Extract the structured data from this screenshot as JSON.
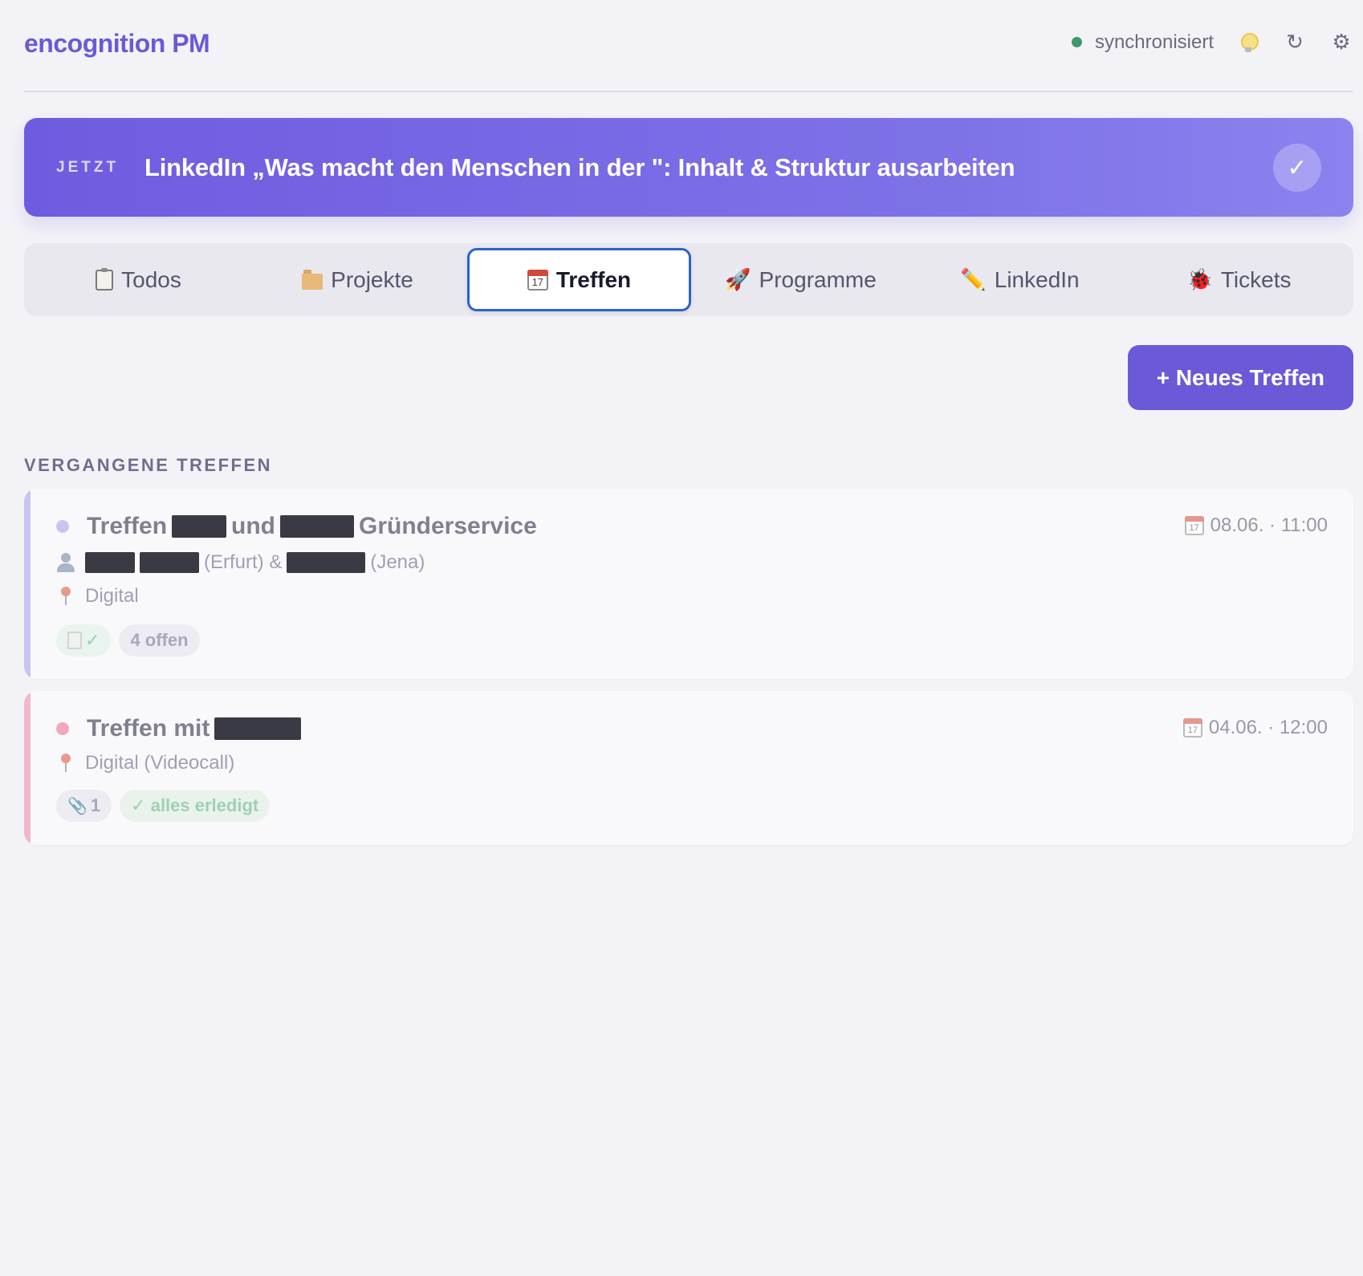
{
  "app": {
    "brand": "encognition PM",
    "sync_status": "synchronisiert",
    "refresh_icon": "↻",
    "settings_icon": "⚙"
  },
  "now": {
    "label": "JETZT",
    "title": "LinkedIn „Was macht den Menschen in der \": Inhalt & Struktur ausarbeiten",
    "done_icon": "✓"
  },
  "tabs": [
    {
      "label": "Todos",
      "icon": "clipboard-icon"
    },
    {
      "label": "Projekte",
      "icon": "folder-icon"
    },
    {
      "label": "Treffen",
      "icon": "calendar-icon",
      "active": true
    },
    {
      "label": "Programme",
      "icon": "rocket-icon",
      "glyph": "🚀"
    },
    {
      "label": "LinkedIn",
      "icon": "pencil-icon",
      "glyph": "✏️"
    },
    {
      "label": "Tickets",
      "icon": "bug-icon",
      "glyph": "🐞"
    }
  ],
  "calendar_day": "17",
  "new_button": "+ Neues Treffen",
  "section_title": "VERGANGENE TREFFEN",
  "meetings": [
    {
      "title_parts": [
        "Treffen",
        "und",
        "Gründerservice"
      ],
      "date": "08.06. · 11:00",
      "participants_a": "(Erfurt) &",
      "participants_b": "(Jena)",
      "location": "Digital",
      "chip_note": "✓",
      "chip_open": "4 offen",
      "status_color": "#c7c3f2"
    },
    {
      "title_parts": [
        "Treffen mit"
      ],
      "date": "04.06. · 12:00",
      "location": "Digital (Videocall)",
      "chip_attachments": "1",
      "chip_done": "✓ alles erledigt",
      "status_color": "#f0a8bc"
    }
  ],
  "colors": {
    "accent": "#6a5ad8",
    "active_tab_border": "#2d62c9",
    "sync_ok": "#3d9a6a"
  }
}
